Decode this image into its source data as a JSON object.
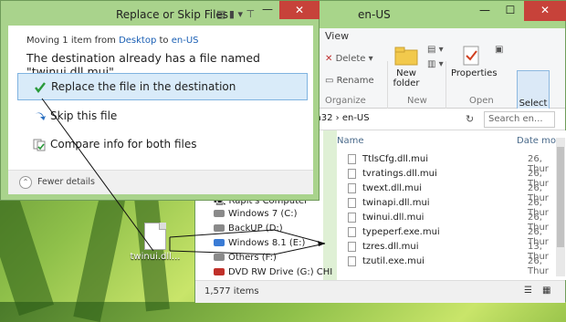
{
  "dialog": {
    "title": "Replace or Skip Files",
    "minimize": "—",
    "close": "✕",
    "moving_prefix": "Moving 1 item from ",
    "moving_from": "Desktop",
    "moving_to_word": " to ",
    "moving_to": "en-US",
    "heading": "The destination already has a file named \"twinui.dll.mui\"",
    "options": [
      {
        "label": "Replace the file in the destination",
        "icon": "check-icon",
        "selected": true
      },
      {
        "label": "Skip this file",
        "icon": "skip-arrow-icon",
        "selected": false
      },
      {
        "label": "Compare info for both files",
        "icon": "compare-icon",
        "selected": false
      }
    ],
    "fewer_details": "Fewer details"
  },
  "desktop_icon": {
    "label": "twinui.dll..."
  },
  "explorer": {
    "title": "en-US",
    "minimize": "—",
    "maximize": "☐",
    "close": "✕",
    "ribbon_tab": "View",
    "delete": "Delete ▾",
    "rename": "Rename",
    "organize_label": "Organize",
    "new_folder": "New folder",
    "new_label": "New",
    "properties": "Properties",
    "open_label": "Open",
    "select": "Select",
    "address": "m32  ›  en-US",
    "search_placeholder": "Search en...",
    "col_name": "Name",
    "col_date": "Date mo",
    "files": [
      {
        "name": "TtlsCfg.dll.mui",
        "date": "26, Thur"
      },
      {
        "name": "tvratings.dll.mui",
        "date": "26, Thur"
      },
      {
        "name": "twext.dll.mui",
        "date": "26, Thur"
      },
      {
        "name": "twinapi.dll.mui",
        "date": "26, Thur"
      },
      {
        "name": "twinui.dll.mui",
        "date": "26, Thur"
      },
      {
        "name": "typeperf.exe.mui",
        "date": "26, Thur"
      },
      {
        "name": "tzres.dll.mui",
        "date": "13, Thur"
      },
      {
        "name": "tzutil.exe.mui",
        "date": "26, Thur"
      }
    ],
    "nav": [
      {
        "label": "Rapit's Computer",
        "icon": "computer-icon"
      },
      {
        "label": "Windows 7 (C:)",
        "icon": "drive-icon"
      },
      {
        "label": "BackUP (D:)",
        "icon": "drive-icon"
      },
      {
        "label": "Windows 8.1 (E:)",
        "icon": "windows-drive-icon"
      },
      {
        "label": "Others (F:)",
        "icon": "drive-icon"
      },
      {
        "label": "DVD RW Drive (G:) CHI",
        "icon": "dvd-drive-icon"
      }
    ],
    "status": "1,577 items"
  },
  "colors": {
    "dialog_frame": "#a9d38c",
    "close_red": "#c7423a",
    "link_blue": "#1a5fb4",
    "selected_bg": "#d9ebf9"
  }
}
